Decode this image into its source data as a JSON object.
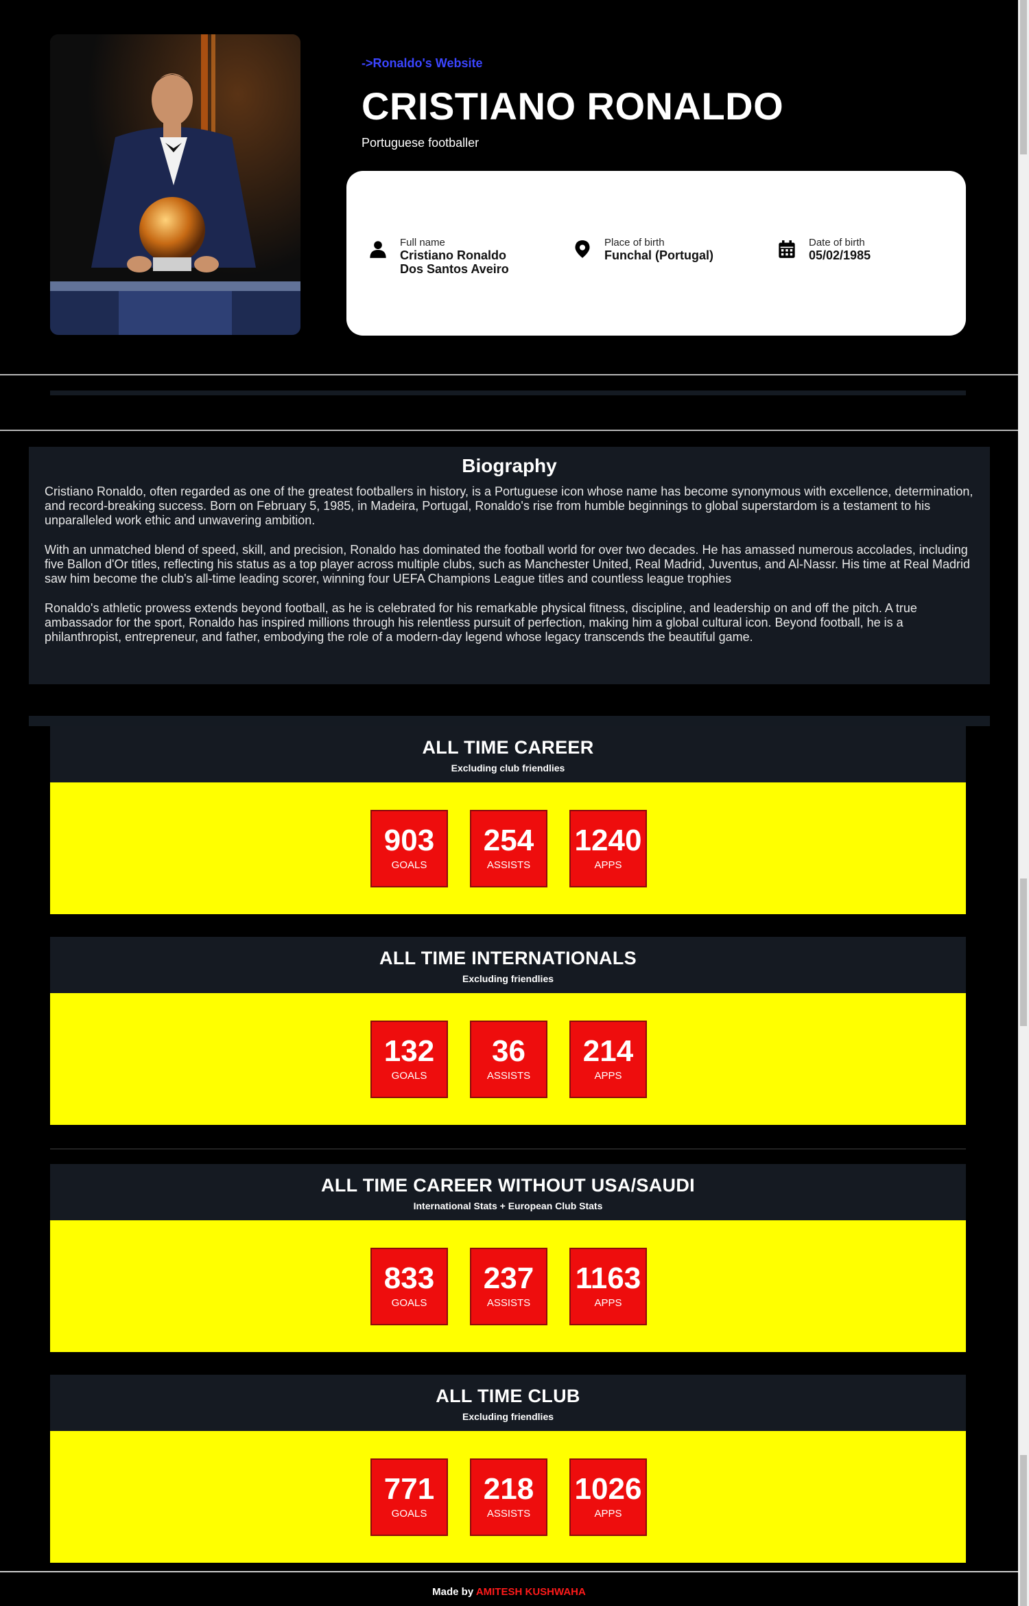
{
  "hero": {
    "website_link": "->Ronaldo's Website",
    "title": "CRISTIANO RONALDO",
    "subtitle": "Portuguese footballer",
    "photo_icon": "ronaldo-ballon-dor-photo"
  },
  "info": {
    "full_name": {
      "label": "Full name",
      "value_line1": "Cristiano Ronaldo",
      "value_line2": "Dos Santos Aveiro",
      "icon": "person-icon"
    },
    "place_of_birth": {
      "label": "Place of birth",
      "value": "Funchal (Portugal)",
      "icon": "location-pin-icon"
    },
    "date_of_birth": {
      "label": "Date of birth",
      "value": "05/02/1985",
      "icon": "calendar-icon"
    }
  },
  "biography": {
    "heading": "Biography",
    "paragraphs": [
      "Cristiano Ronaldo, often regarded as one of the greatest footballers in history, is a Portuguese icon whose name has become synonymous with excellence, determination, and record-breaking success. Born on February 5, 1985, in Madeira, Portugal, Ronaldo's rise from humble beginnings to global superstardom is a testament to his unparalleled work ethic and unwavering ambition.",
      "With an unmatched blend of speed, skill, and precision, Ronaldo has dominated the football world for over two decades. He has amassed numerous accolades, including five Ballon d'Or titles, reflecting his status as a top player across multiple clubs, such as Manchester United, Real Madrid, Juventus, and Al-Nassr. His time at Real Madrid saw him become the club's all-time leading scorer, winning four UEFA Champions League titles and countless league trophies",
      "Ronaldo's athletic prowess extends beyond football, as he is celebrated for his remarkable physical fitness, discipline, and leadership on and off the pitch. A true ambassador for the sport, Ronaldo has inspired millions through his relentless pursuit of perfection, making him a global cultural icon. Beyond football, he is a philanthropist, entrepreneur, and father, embodying the role of a modern-day legend whose legacy transcends the beautiful game."
    ]
  },
  "stats": [
    {
      "title": "ALL TIME CAREER",
      "subtitle": "Excluding club friendlies",
      "goals": "903",
      "assists": "254",
      "apps": "1240"
    },
    {
      "title": "ALL TIME INTERNATIONALS",
      "subtitle": "Excluding friendlies",
      "goals": "132",
      "assists": "36",
      "apps": "214"
    },
    {
      "title": "ALL TIME CAREER WITHOUT USA/SAUDI",
      "subtitle": "International Stats + European Club Stats",
      "goals": "833",
      "assists": "237",
      "apps": "1163"
    },
    {
      "title": "ALL TIME CLUB",
      "subtitle": "Excluding friendlies",
      "goals": "771",
      "assists": "218",
      "apps": "1026"
    }
  ],
  "stat_labels": {
    "goals": "GOALS",
    "assists": "ASSISTS",
    "apps": "APPS"
  },
  "footer": {
    "prefix": "Made by ",
    "author": "AMITESH KUSHWAHA"
  },
  "colors": {
    "background": "#000000",
    "link": "#3b45ff",
    "panel": "#151a22",
    "stat_band": "#ffff00",
    "stat_box": "#ee0d0d",
    "author": "#ff1a1a"
  }
}
